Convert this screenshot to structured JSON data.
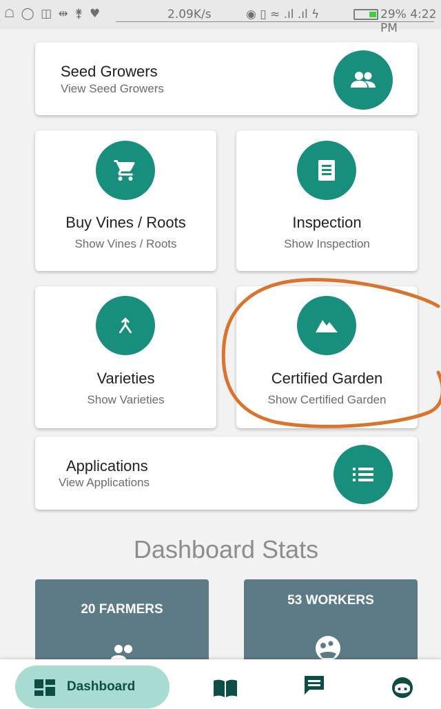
{
  "status_bar": {
    "left_icons": "☖ ◯ ◫ ⇹ ⚵ ♥",
    "speed": "2.09K/s",
    "signal_icons": "◉ ▯ ≈ .ıl .ıl ϟ",
    "battery": "29%",
    "time": "4:22 PM"
  },
  "menu": {
    "seed_growers": {
      "title": "Seed Growers",
      "subtitle": "View Seed Growers",
      "icon": "people-icon"
    },
    "buy_vines": {
      "title": "Buy Vines / Roots",
      "subtitle": "Show Vines / Roots",
      "icon": "cart-icon"
    },
    "inspection": {
      "title": "Inspection",
      "subtitle": "Show Inspection",
      "icon": "receipt-icon"
    },
    "varieties": {
      "title": "Varieties",
      "subtitle": "Show Varieties",
      "icon": "merge-icon"
    },
    "certified_garden": {
      "title": "Certified Garden",
      "subtitle": "Show Certified Garden",
      "icon": "terrain-icon"
    },
    "applications": {
      "title": "Applications",
      "subtitle": "View Applications",
      "icon": "list-icon"
    }
  },
  "stats": {
    "heading": "Dashboard Stats",
    "farmers": "20 FARMERS",
    "workers": "53 WORKERS"
  },
  "bottom_nav": {
    "dashboard": "Dashboard",
    "items": [
      "dashboard-icon",
      "book-icon",
      "chat-icon",
      "face-icon"
    ]
  },
  "colors": {
    "accent": "#178f7c",
    "stat_card": "#5d7b86",
    "nav_pill": "#a8dcd2",
    "annotation": "#d9742f"
  }
}
